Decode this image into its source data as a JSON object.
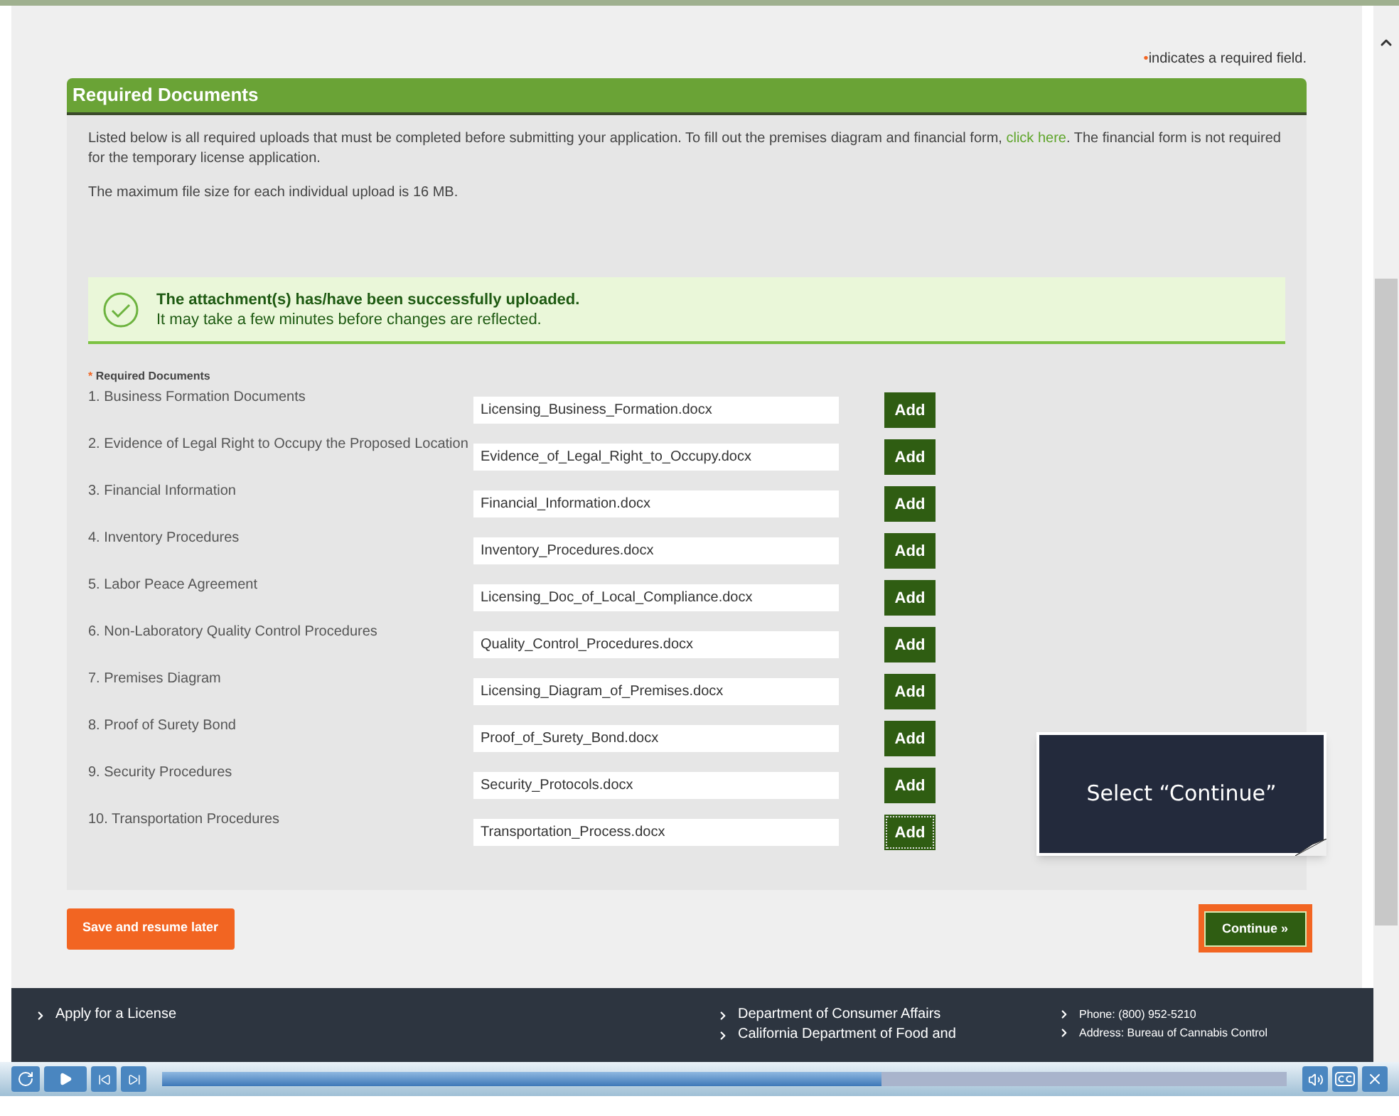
{
  "required_note": {
    "marker": "•",
    "text": "indicates a required field."
  },
  "panel": {
    "title": "Required Documents",
    "intro": "Listed below is all required uploads that must be completed before submitting your application. To fill out the premises diagram and financial form, ",
    "link": "click here",
    "intro_end": ". The financial form is not required for the temporary license application.",
    "max_size": "The maximum file size for each individual upload is 16 MB.",
    "alert": {
      "title": "The attachment(s) has/have been successfully uploaded.",
      "message": "It may take a few minutes before changes are reflected."
    },
    "list_label": {
      "marker": "*",
      "text": "Required Documents"
    },
    "documents": [
      {
        "label": "1. Business Formation Documents",
        "file": "Licensing_Business_Formation.docx",
        "button": "Add",
        "focused": false
      },
      {
        "label": "2. Evidence of Legal Right to Occupy the Proposed Location",
        "file": "Evidence_of_Legal_Right_to_Occupy.docx",
        "button": "Add",
        "focused": false
      },
      {
        "label": "3. Financial Information",
        "file": "Financial_Information.docx",
        "button": "Add",
        "focused": false
      },
      {
        "label": "4. Inventory Procedures",
        "file": "Inventory_Procedures.docx",
        "button": "Add",
        "focused": false
      },
      {
        "label": "5. Labor Peace Agreement",
        "file": "Licensing_Doc_of_Local_Compliance.docx",
        "button": "Add",
        "focused": false
      },
      {
        "label": "6. Non-Laboratory Quality Control Procedures",
        "file": "Quality_Control_Procedures.docx",
        "button": "Add",
        "focused": false
      },
      {
        "label": "7. Premises Diagram",
        "file": "Licensing_Diagram_of_Premises.docx",
        "button": "Add",
        "focused": false
      },
      {
        "label": "8. Proof of Surety Bond",
        "file": "Proof_of_Surety_Bond.docx",
        "button": "Add",
        "focused": false
      },
      {
        "label": "9. Security Procedures",
        "file": "Security_Protocols.docx",
        "button": "Add",
        "focused": false
      },
      {
        "label": "10. Transportation Procedures",
        "file": "Transportation_Process.docx",
        "button": "Add",
        "focused": true
      }
    ]
  },
  "actions": {
    "save": "Save and resume later",
    "continue": "Continue »",
    "continue_highlighted": true
  },
  "tooltip": "Select “Continue”",
  "footer": {
    "column_1": [
      "Apply for a License"
    ],
    "column_2": [
      "Department of Consumer Affairs",
      "California Department of Food and"
    ],
    "column_3": [
      "Phone: (800) 952-5210",
      "Address: Bureau of Cannabis Control"
    ]
  },
  "player": {
    "progress": {
      "level": 0.64
    }
  }
}
